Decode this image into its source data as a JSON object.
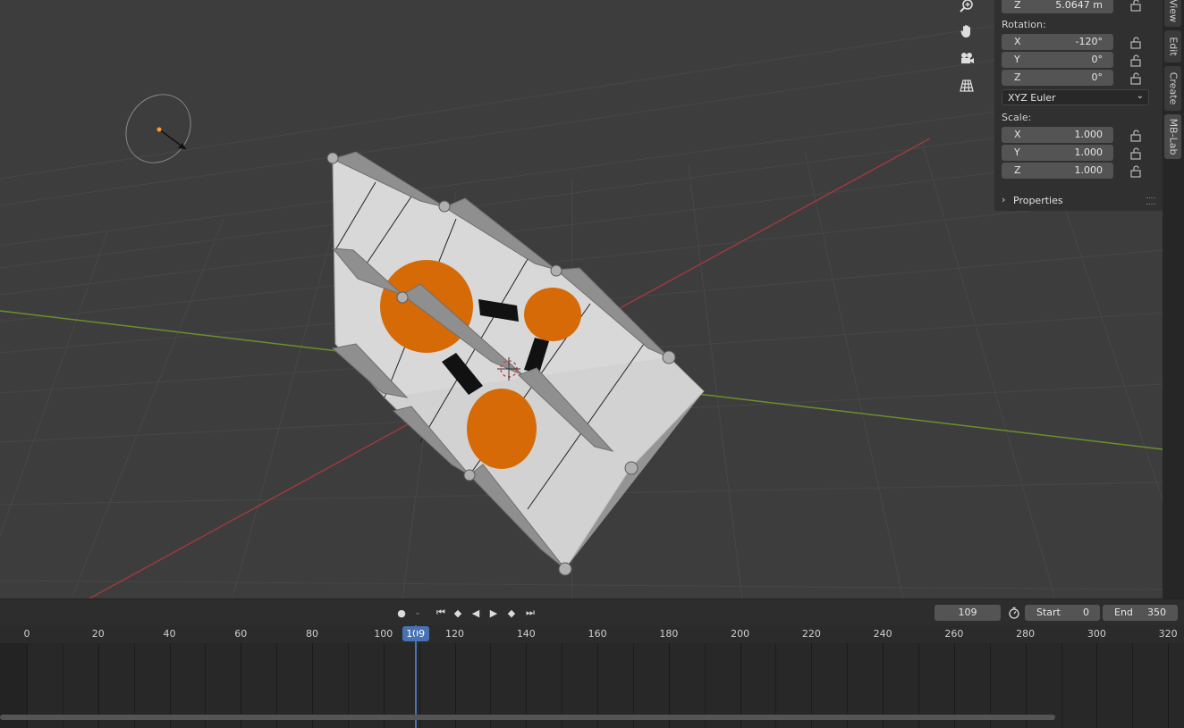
{
  "transform_panel": {
    "location_z": {
      "axis": "Z",
      "value": "5.0647 m"
    },
    "rotation_label": "Rotation:",
    "rotation": [
      {
        "axis": "X",
        "value": "-120°"
      },
      {
        "axis": "Y",
        "value": "0°"
      },
      {
        "axis": "Z",
        "value": "0°"
      }
    ],
    "rotation_mode": "XYZ Euler",
    "scale_label": "Scale:",
    "scale": [
      {
        "axis": "X",
        "value": "1.000"
      },
      {
        "axis": "Y",
        "value": "1.000"
      },
      {
        "axis": "Z",
        "value": "1.000"
      }
    ],
    "properties_label": "Properties"
  },
  "sidebar_tabs": [
    "View",
    "Edit",
    "Create",
    "MB-Lab"
  ],
  "nav_gizmos": [
    "zoom-icon",
    "hand-pan-icon",
    "camera-icon",
    "grid-ortho-icon"
  ],
  "timeline": {
    "current_frame": "109",
    "start_label": "Start",
    "start_value": "0",
    "end_label": "End",
    "end_value": "350",
    "ruler_ticks": [
      "0",
      "20",
      "40",
      "60",
      "80",
      "100",
      "120",
      "140",
      "160",
      "180",
      "200",
      "220",
      "240",
      "260",
      "280",
      "300",
      "320"
    ],
    "playhead_frame": "109"
  },
  "colors": {
    "accent": "#4772b3",
    "orange": "#d66a07",
    "x_axis": "#9c3a3f",
    "y_axis": "#6b8f2b"
  }
}
